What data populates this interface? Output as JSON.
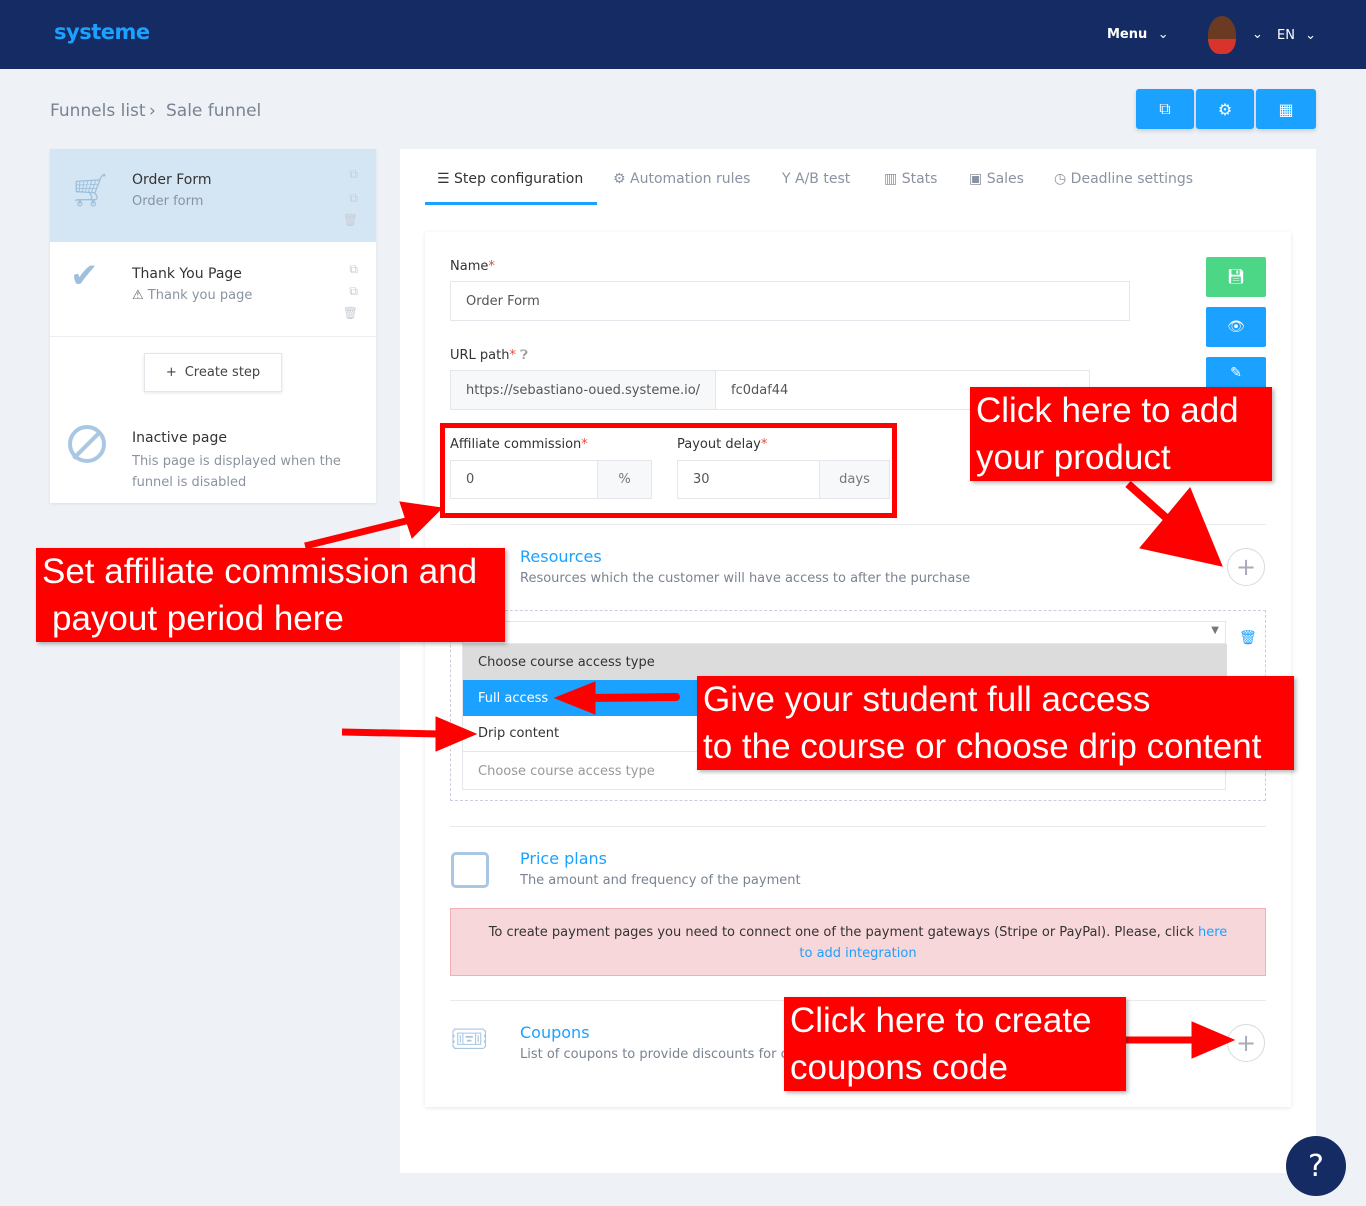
{
  "header": {
    "logo": "systeme",
    "menu": "Menu",
    "lang": "EN"
  },
  "breadcrumb": {
    "items": [
      "Funnels list",
      "Sale funnel"
    ]
  },
  "toolbar": {
    "icons": [
      "external-link-icon",
      "gear-icon",
      "shop-icon"
    ]
  },
  "steps": [
    {
      "title": "Order Form",
      "subtitle": "Order form",
      "icon": "cart-icon"
    },
    {
      "title": "Thank You Page",
      "subtitle": "Thank you page",
      "icon": "check-icon"
    }
  ],
  "create_step": "Create step",
  "inactive": {
    "title": "Inactive page",
    "subtitle": "This page is displayed when the funnel is disabled"
  },
  "tabs": [
    {
      "label": "Step configuration",
      "icon": "☰"
    },
    {
      "label": "Automation rules",
      "icon": "⚙"
    },
    {
      "label": "A/B test",
      "icon": "Y"
    },
    {
      "label": "Stats",
      "icon": "▥"
    },
    {
      "label": "Sales",
      "icon": "▣"
    },
    {
      "label": "Deadline settings",
      "icon": "◷"
    }
  ],
  "form": {
    "name_label": "Name",
    "name_value": "Order Form",
    "url_label": "URL path",
    "url_base": "https://sebastiano-oued.systeme.io/",
    "url_value": "fc0daf44",
    "affiliate_label": "Affiliate commission",
    "affiliate_value": "0",
    "affiliate_unit": "%",
    "payout_label": "Payout delay",
    "payout_value": "30",
    "payout_unit": "days"
  },
  "resources": {
    "title": "Resources",
    "subtitle": "Resources which the customer will have access to after the purchase",
    "dropdown_options": [
      "Choose course access type",
      "Full access",
      "Drip content"
    ],
    "placeholder": "Choose course access type"
  },
  "price_plans": {
    "title": "Price plans",
    "subtitle": "The amount and frequency of the payment",
    "alert": "To create payment pages you need to connect one of the payment gateways (Stripe or PayPal). Please, click ",
    "alert_link": "here to add integration"
  },
  "coupons": {
    "title": "Coupons",
    "subtitle": "List of coupons to provide discounts for c"
  },
  "annotations": {
    "affiliate": [
      "Set affiliate commission and",
      "payout period here"
    ],
    "product": [
      "Click here to add",
      "your product"
    ],
    "access": [
      "Give your student full access",
      "to the course or choose drip content"
    ],
    "coupons": [
      "Click here to create",
      "coupons code"
    ]
  },
  "help": "?",
  "colors": {
    "header": "#142c63",
    "accent": "#1ba1ff",
    "annotation": "#ff0000",
    "save": "#4cd787"
  }
}
